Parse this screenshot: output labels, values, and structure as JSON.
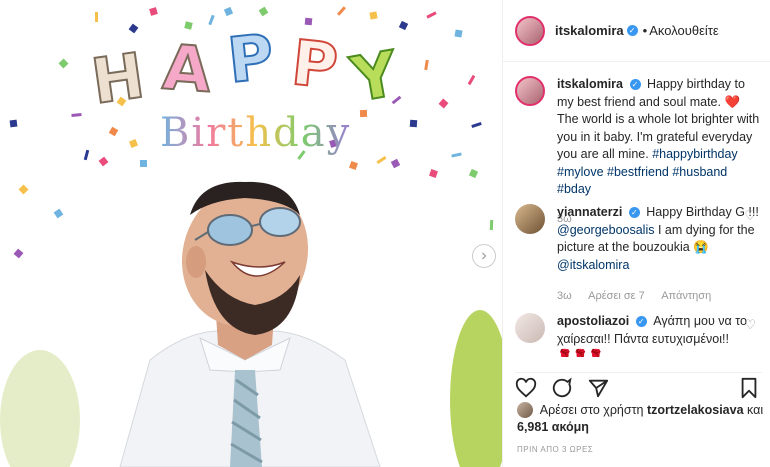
{
  "post": {
    "image_title_letters": [
      "H",
      "A",
      "P",
      "P",
      "Y"
    ],
    "image_subtitle": "Birthday"
  },
  "header": {
    "username": "itskalomira",
    "separator": "•",
    "follow_label": "Ακολουθείτε"
  },
  "caption": {
    "username": "itskalomira",
    "text_before_heart": "Happy birthday to my best friend and soul mate.",
    "text_after_heart": "The world is a whole lot brighter with you in it baby. I'm grateful everyday you are all mine.",
    "hashtags": "#happybirthday #mylove #bestfriend #husband #bday",
    "age": "3ω"
  },
  "comments": [
    {
      "username": "yiannaterzi",
      "text_1": "Happy Birthday G !!!",
      "mention_1": "@georgeboosalis",
      "text_2": "I am dying for the picture at the bouzoukia 😭",
      "mention_2": "@itskalomira",
      "age": "3ω",
      "likes": "Αρέσει σε 7",
      "reply": "Απάντηση"
    },
    {
      "username": "apostoliazoi",
      "text": "Αγάπη μου να το χαίρεσαι!! Πάντα ευτυχισμένοι!!",
      "emoji": "🌹🌹🌹"
    }
  ],
  "likes": {
    "prefix": "Αρέσει στο χρήστη",
    "user": "tzortzelakosiava",
    "conj": "και",
    "count": "6,981 ακόμη"
  },
  "timestamp": "ΠΡΙΝ ΑΠΟ 3 ΩΡΕΣ",
  "icons": [
    "heart-icon",
    "comment-icon",
    "share-icon",
    "bookmark-icon",
    "chevron-right-icon",
    "verified-icon"
  ],
  "colors": {
    "accent_blue": "#3897f0",
    "link": "#003569",
    "heart_red": "#ed4956",
    "muted": "#999999"
  }
}
